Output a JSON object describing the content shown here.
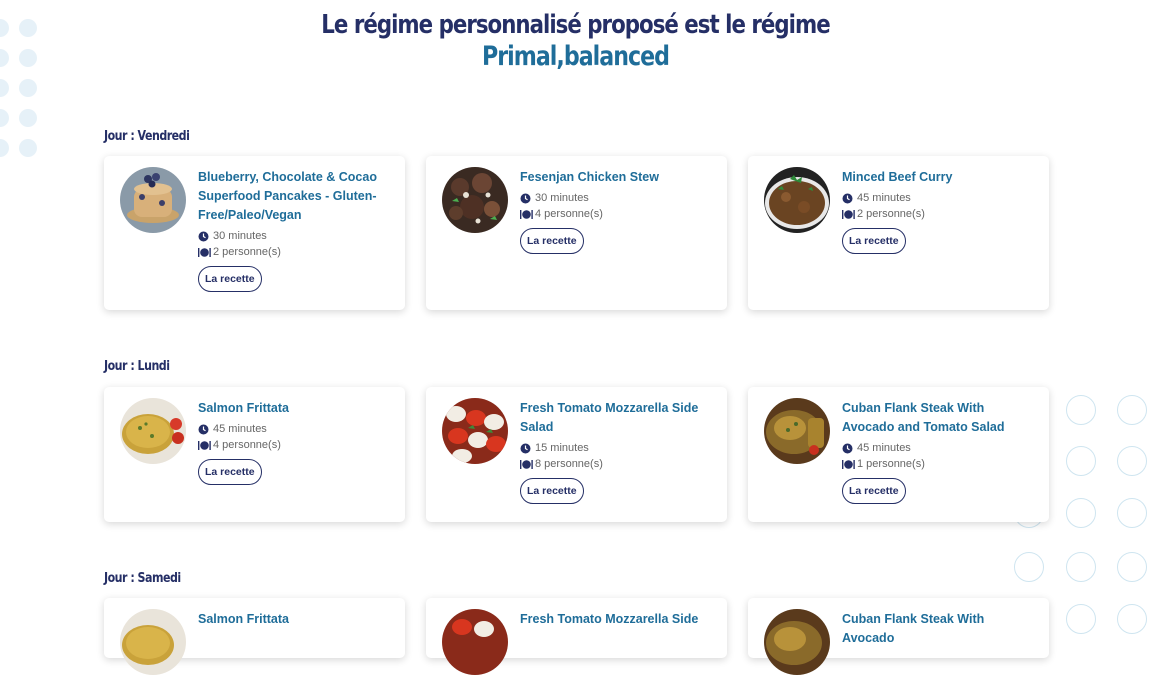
{
  "header": {
    "title_line1": "Le régime personnalisé proposé est le régime",
    "title_line2": "Primal,balanced"
  },
  "recipe_button_label": "La recette",
  "days": [
    {
      "label": "Jour : Vendredi",
      "recipes": [
        {
          "name": "Blueberry, Chocolate & Cocao Superfood Pancakes - Gluten-Free/Paleo/Vegan",
          "time": "30 minutes",
          "servings": "2 personne(s)",
          "image": "pancakes"
        },
        {
          "name": "Fesenjan Chicken Stew",
          "time": "30 minutes",
          "servings": "4 personne(s)",
          "image": "stew"
        },
        {
          "name": "Minced Beef Curry",
          "time": "45 minutes",
          "servings": "2 personne(s)",
          "image": "curry"
        }
      ]
    },
    {
      "label": "Jour : Lundi",
      "recipes": [
        {
          "name": "Salmon Frittata",
          "time": "45 minutes",
          "servings": "4 personne(s)",
          "image": "frittata"
        },
        {
          "name": "Fresh Tomato Mozzarella Side Salad",
          "time": "15 minutes",
          "servings": "8 personne(s)",
          "image": "caprese"
        },
        {
          "name": "Cuban Flank Steak With Avocado and Tomato Salad",
          "time": "45 minutes",
          "servings": "1 personne(s)",
          "image": "steak"
        }
      ]
    },
    {
      "label": "Jour : Samedi",
      "recipes": [
        {
          "name": "Salmon Frittata",
          "image": "frittata"
        },
        {
          "name": "Fresh Tomato Mozzarella Side",
          "image": "caprese"
        },
        {
          "name": "Cuban Flank Steak With Avocado",
          "image": "steak"
        }
      ]
    }
  ],
  "icons": {
    "time": "clock-icon",
    "servings": "plate-cutlery-icon"
  },
  "colors": {
    "title_dark": "#252f66",
    "title_accent": "#1f6d99",
    "link": "#1f6d99"
  }
}
